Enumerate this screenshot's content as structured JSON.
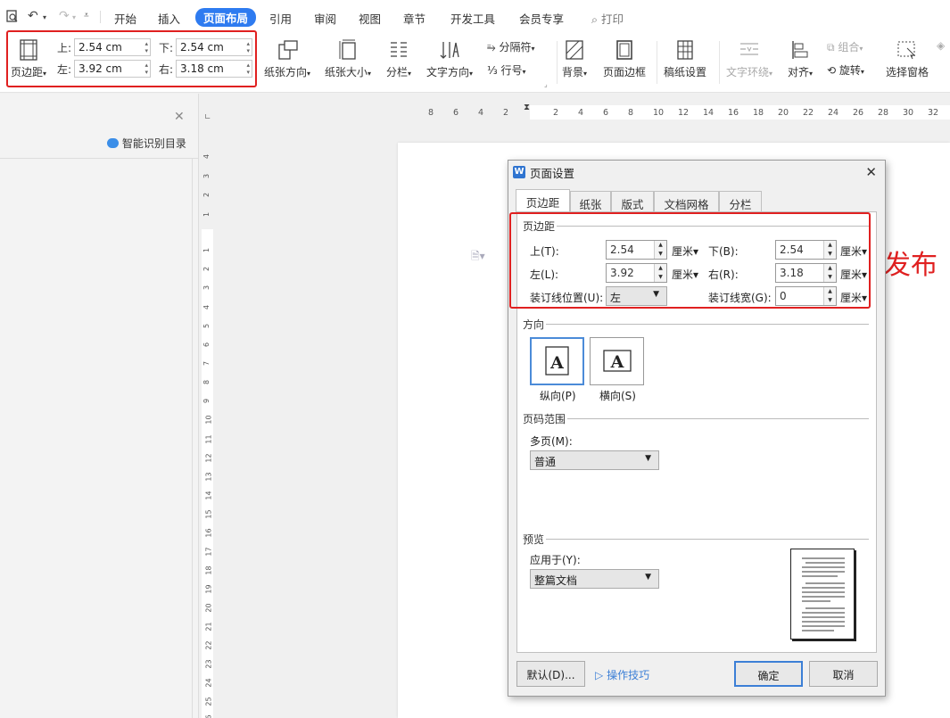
{
  "menubar": {
    "tabs": [
      "开始",
      "插入",
      "页面布局",
      "引用",
      "审阅",
      "视图",
      "章节",
      "开发工具",
      "会员专享"
    ],
    "active_tab": "页面布局",
    "search_label": "打印"
  },
  "ribbon": {
    "margins_button": "页边距",
    "top_label": "上:",
    "top_value": "2.54 cm",
    "bottom_label": "下:",
    "bottom_value": "2.54 cm",
    "left_label": "左:",
    "left_value": "3.92 cm",
    "right_label": "右:",
    "right_value": "3.18 cm",
    "orientation": "纸张方向",
    "size": "纸张大小",
    "columns": "分栏",
    "text_direction": "文字方向",
    "separator": "分隔符",
    "line_number": "行号",
    "background": "背景",
    "page_border": "页面边框",
    "manuscript": "稿纸设置",
    "text_wrap": "文字环绕",
    "align": "对齐",
    "group": "组合",
    "rotate": "旋转",
    "selection_pane": "选择窗格"
  },
  "left_panel": {
    "smart_toc": "智能识别目录"
  },
  "hruler": {
    "numbers": [
      "8",
      "6",
      "4",
      "2",
      "2",
      "4",
      "6",
      "8",
      "10",
      "12",
      "14",
      "16",
      "18",
      "20",
      "22",
      "24",
      "26",
      "28",
      "30",
      "32"
    ]
  },
  "vruler": {
    "numbers": [
      "4",
      "3",
      "2",
      "1",
      "1",
      "2",
      "3",
      "4",
      "5",
      "6",
      "7",
      "8",
      "9",
      "10",
      "11",
      "12",
      "13",
      "14",
      "15",
      "16",
      "17",
      "18",
      "19",
      "20",
      "21",
      "22",
      "23",
      "24",
      "25",
      "26"
    ]
  },
  "document": {
    "visible_text": "发布"
  },
  "dialog": {
    "title": "页面设置",
    "tabs": [
      "页边距",
      "纸张",
      "版式",
      "文档网格",
      "分栏"
    ],
    "margins_section": "页边距",
    "top_label": "上(T):",
    "top_value": "2.54",
    "bottom_label": "下(B):",
    "bottom_value": "2.54",
    "left_label": "左(L):",
    "left_value": "3.92",
    "right_label": "右(R):",
    "right_value": "3.18",
    "unit": "厘米",
    "gutter_pos_label": "装订线位置(U):",
    "gutter_pos_value": "左",
    "gutter_width_label": "装订线宽(G):",
    "gutter_width_value": "0",
    "orientation_section": "方向",
    "portrait": "纵向(P)",
    "landscape": "横向(S)",
    "page_range_section": "页码范围",
    "multi_page_label": "多页(M):",
    "multi_page_value": "普通",
    "preview_section": "预览",
    "apply_to_label": "应用于(Y):",
    "apply_to_value": "整篇文档",
    "default_button": "默认(D)...",
    "tips_link": "操作技巧",
    "ok_button": "确定",
    "cancel_button": "取消"
  },
  "colors": {
    "accent": "#2e7bf0",
    "highlight_box": "#e02020"
  }
}
